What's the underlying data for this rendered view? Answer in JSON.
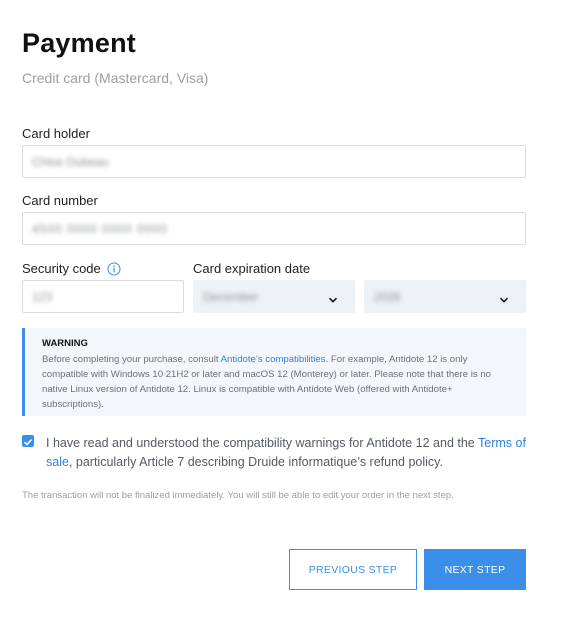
{
  "page": {
    "title": "Payment",
    "subtitle": "Credit card (Mastercard, Visa)"
  },
  "form": {
    "card_holder_label": "Card holder",
    "card_holder_value": "Chloe Dubeau",
    "card_number_label": "Card number",
    "card_number_value": "4500 0000 0000 0000",
    "security_code_label": "Security code",
    "security_code_value": "123",
    "expiration_label": "Card expiration date",
    "expiration_month": "December",
    "expiration_year": "2026"
  },
  "warning": {
    "title": "WARNING",
    "text_before_link": "Before completing your purchase, consult ",
    "link_text": "Antidote’s compatibilities",
    "text_after_link": ". For example, Antidote 12 is only compatible with Windows 10 21H2 or later and macOS 12 (Monterey) or later. Please note that there is no native Linux version of Antidote 12. Linux is compatible with Antidote Web (offered with Antidote+ subscriptions)."
  },
  "consent": {
    "checked": true,
    "text_before_link": "I have read and understood the compatibility warnings for Antidote 12 and the ",
    "link_text": "Terms of sale",
    "text_after_link": ", particularly Article 7 describing Druide informatique’s refund policy."
  },
  "note": "The transaction will not be finalized immediately. You will still be able to edit your order in the next step.",
  "buttons": {
    "previous": "PREVIOUS STEP",
    "next": "NEXT STEP"
  },
  "colors": {
    "accent": "#3b8fe8",
    "link": "#2f7fd8",
    "warning_bg": "#f3f7fb"
  },
  "icons": {
    "info": "info-icon",
    "chevron": "chevron-down-icon",
    "check": "check-icon"
  }
}
